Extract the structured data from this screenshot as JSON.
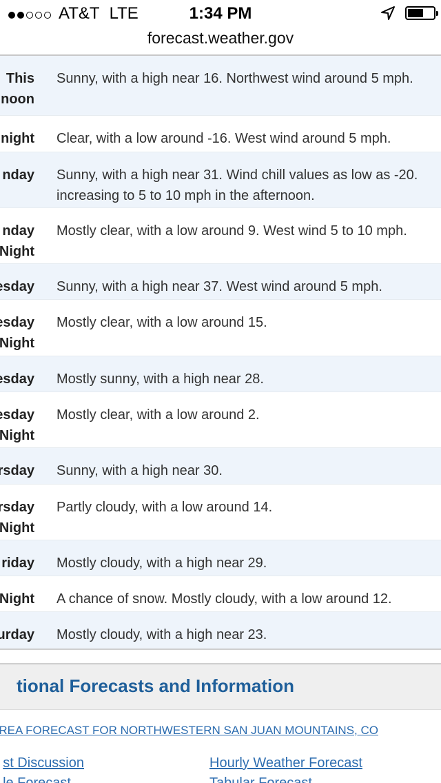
{
  "status_bar": {
    "signal_dots": [
      true,
      true,
      false,
      false,
      false
    ],
    "carrier": "AT&T",
    "network": "LTE",
    "time": "1:34 PM",
    "battery_level": 0.6,
    "location_icon": "location-arrow-icon",
    "battery_icon": "battery-icon"
  },
  "browser": {
    "url": "forecast.weather.gov"
  },
  "forecast": [
    {
      "label_lines": [
        "This",
        "noon"
      ],
      "description": "Sunny, with a high near 16. Northwest wind around 5 mph."
    },
    {
      "label_lines": [
        "night"
      ],
      "description": "Clear, with a low around -16. West wind around 5 mph."
    },
    {
      "label_lines": [
        "nday"
      ],
      "description_lines": [
        "Sunny, with a high near 31. Wind chill values as low as -20.",
        "increasing to 5 to 10 mph in the afternoon."
      ]
    },
    {
      "label_lines": [
        "nday",
        "Night"
      ],
      "description": "Mostly clear, with a low around 9. West wind 5 to 10 mph."
    },
    {
      "label_lines": [
        "esday"
      ],
      "description": "Sunny, with a high near 37. West wind around 5 mph."
    },
    {
      "label_lines": [
        "esday",
        "Night"
      ],
      "description": "Mostly clear, with a low around 15."
    },
    {
      "label_lines": [
        "esday"
      ],
      "description": "Mostly sunny, with a high near 28."
    },
    {
      "label_lines": [
        "esday",
        "Night"
      ],
      "description": "Mostly clear, with a low around 2."
    },
    {
      "label_lines": [
        "rsday"
      ],
      "description": "Sunny, with a high near 30."
    },
    {
      "label_lines": [
        "rsday",
        "Night"
      ],
      "description": "Partly cloudy, with a low around 14."
    },
    {
      "label_lines": [
        "riday"
      ],
      "description": "Mostly cloudy, with a high near 29."
    },
    {
      "label_lines": [
        "Night"
      ],
      "description": "A chance of snow. Mostly cloudy, with a low around 12."
    },
    {
      "label_lines": [
        "urday"
      ],
      "description": "Mostly cloudy, with a high near 23."
    }
  ],
  "additional_info": {
    "title": "tional Forecasts and Information",
    "area_link": "REA FORECAST FOR NORTHWESTERN SAN JUAN MOUNTAINS, CO",
    "links": {
      "discussion": "st Discussion",
      "hourly": "Hourly Weather Forecast",
      "graph": "le Forecast",
      "tabular": "Tabular Forecast"
    }
  },
  "colors": {
    "row_alt": "#eef4fb",
    "link": "#2d6db0",
    "section_title": "#1f5f9a"
  }
}
